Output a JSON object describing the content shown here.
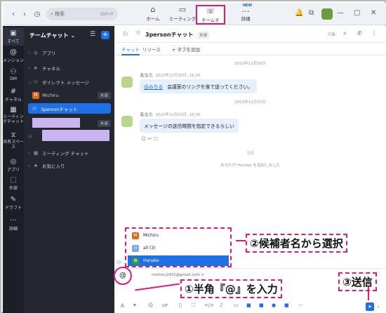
{
  "window": {
    "search_placeholder": "検索",
    "search_shortcut": "Ctrl+F",
    "tabs": [
      {
        "label": "ホーム",
        "icon": "home-icon"
      },
      {
        "label": "ミーティング",
        "icon": "video-icon"
      },
      {
        "label": "チームチャ...",
        "icon": "team-chat-icon",
        "active": true
      },
      {
        "label": "詳細",
        "icon": "more-icon",
        "badge": "NEW"
      }
    ]
  },
  "rail": {
    "items": [
      {
        "label": "すべて",
        "icon": "chat-bubble-icon"
      },
      {
        "label": "メンション",
        "icon": "at-icon"
      },
      {
        "label": "DM",
        "icon": "people-icon"
      },
      {
        "label": "チャネル",
        "icon": "hash-icon"
      },
      {
        "label": "ミーティングチャット",
        "icon": "calendar-icon"
      },
      {
        "label": "共有スペース",
        "icon": "shared-space-icon"
      },
      {
        "label": "アプリ",
        "icon": "apps-icon"
      },
      {
        "label": "外部",
        "icon": "external-icon"
      },
      {
        "label": "ドラフト",
        "icon": "draft-icon"
      },
      {
        "label": "詳細",
        "icon": "more-icon"
      }
    ]
  },
  "sidebar": {
    "title": "チームチャット",
    "sections": {
      "apps": "アプリ",
      "channels": "チャネル",
      "direct": "ダイレクト メッセージ",
      "meeting_chat": "ミーティング チャット",
      "favorites": "お気に入り"
    },
    "dm_items": [
      {
        "name": "Michiru",
        "tag": "外部"
      },
      {
        "name": "3personチャット",
        "selected": true
      },
      {
        "name": "",
        "tag": "外部"
      },
      {
        "name": ""
      }
    ]
  },
  "channel": {
    "title": "3personチャット",
    "tag": "外部",
    "member_count": "3",
    "tabs": [
      "チャット",
      "リソース",
      "+ タブを追加"
    ]
  },
  "messages": [
    {
      "date": "2023年11月30日",
      "sender": "あなた",
      "time": "2023年11月30日, 16:00",
      "mention": "@みちる",
      "text": "会議室のリンクを後で送ってください。"
    },
    {
      "date": "2023年12月25日",
      "sender": "あなた",
      "time": "2023年12月25日, 16:00",
      "text": "メッセージの送信時間を指定できるらしい"
    }
  ],
  "today_label": "今日",
  "system_message": "あなたが Hanako を追加しました",
  "mention_popup": {
    "items": [
      {
        "name": "Michiru",
        "avatar_color": "#e06a1b"
      },
      {
        "name": "all (3)",
        "avatar_color": "#7fa9e6"
      },
      {
        "name": "Hanako",
        "avatar_color": "#2c9b4b",
        "highlighted": true
      }
    ]
  },
  "input": {
    "at_symbol": "@",
    "recipient_email": "michiru2432@gmail.com ×"
  },
  "annotations": {
    "step1": "①半角『@』を入力",
    "step2": "②候補者名から選択",
    "step3": "③送信"
  },
  "colors": {
    "accent": "#1f6fe6",
    "annotation": "#e0197d",
    "sidebar_bg": "#23272f",
    "rail_bg": "#1b1f27"
  }
}
